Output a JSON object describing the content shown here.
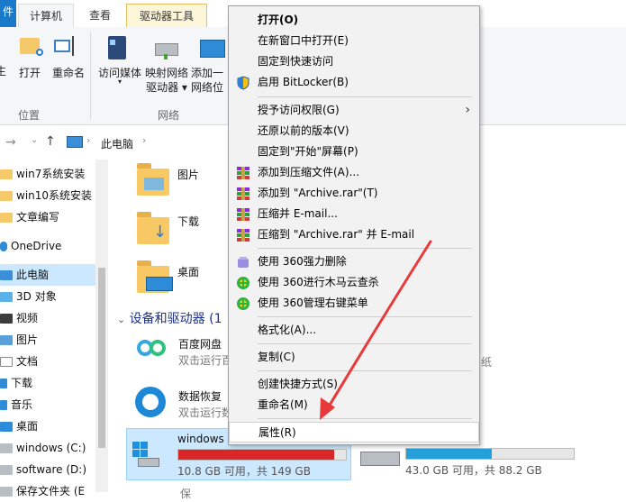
{
  "ribbon": {
    "tabs": [
      {
        "label": "件"
      },
      {
        "label": "计算机"
      },
      {
        "label": "查看"
      },
      {
        "label": "驱动器工具"
      }
    ],
    "buttons": {
      "open": "打开",
      "rename": "重命名",
      "media_line1": "访问媒体",
      "map_line1": "映射网络",
      "map_line2": "驱动器",
      "add_line1": "添加一",
      "add_line2": "网络位"
    },
    "groups": {
      "location": "位置",
      "network": "网络"
    },
    "left_cut": "生"
  },
  "address": {
    "path": "此电脑"
  },
  "nav": {
    "items": [
      {
        "label": "win7系统安装"
      },
      {
        "label": "win10系统安装"
      },
      {
        "label": "文章编写"
      },
      {
        "label": "OneDrive"
      },
      {
        "label": "此电脑"
      },
      {
        "label": "3D 对象"
      },
      {
        "label": "视频"
      },
      {
        "label": "图片"
      },
      {
        "label": "文档"
      },
      {
        "label": "下载"
      },
      {
        "label": "音乐"
      },
      {
        "label": "桌面"
      },
      {
        "label": "windows (C:)"
      },
      {
        "label": "software (D:)"
      },
      {
        "label": "保存文件夹 (E"
      }
    ]
  },
  "main": {
    "folders": [
      {
        "label": "图片"
      },
      {
        "label": "下载"
      },
      {
        "label": "桌面"
      }
    ],
    "section_header": "设备和驱动器 (1",
    "apps": [
      {
        "title": "百度网盘",
        "sub": "双击运行百"
      },
      {
        "title": "数据恢复",
        "sub": "双击运行数"
      }
    ],
    "drives": [
      {
        "name": "windows",
        "free": "10.8 GB 可用，共 149 GB",
        "fill": 0.93,
        "color": "#da2626"
      },
      {
        "name": "",
        "free": "43.0 GB 可用，共 88.2 GB",
        "fill": 0.51,
        "color": "#26a0da"
      }
    ],
    "cut_text_right": "纸",
    "bottom_cut": "保"
  },
  "context_menu": {
    "items": [
      {
        "label": "打开(O)",
        "bold": true
      },
      {
        "label": "在新窗口中打开(E)"
      },
      {
        "label": "固定到快速访问"
      },
      {
        "label": "启用 BitLocker(B)",
        "icon": "shield-icon"
      },
      {
        "label": "授予访问权限(G)",
        "submenu": true
      },
      {
        "label": "还原以前的版本(V)"
      },
      {
        "label": "固定到\"开始\"屏幕(P)"
      },
      {
        "label": "添加到压缩文件(A)...",
        "icon": "winrar-icon"
      },
      {
        "label": "添加到 \"Archive.rar\"(T)",
        "icon": "winrar-icon"
      },
      {
        "label": "压缩并 E-mail...",
        "icon": "winrar-icon"
      },
      {
        "label": "压缩到 \"Archive.rar\" 并 E-mail",
        "icon": "winrar-icon"
      },
      {
        "label": "使用 360强力删除",
        "icon": "360-delete-icon"
      },
      {
        "label": "使用 360进行木马云查杀",
        "icon": "360-scan-icon"
      },
      {
        "label": "使用 360管理右键菜单",
        "icon": "360-scan-icon"
      },
      {
        "label": "格式化(A)..."
      },
      {
        "label": "复制(C)"
      },
      {
        "label": "创建快捷方式(S)"
      },
      {
        "label": "重命名(M)"
      },
      {
        "label": "属性(R)",
        "highlighted": true
      }
    ]
  },
  "annotation": {
    "arrow_color": "#e83a3a"
  }
}
